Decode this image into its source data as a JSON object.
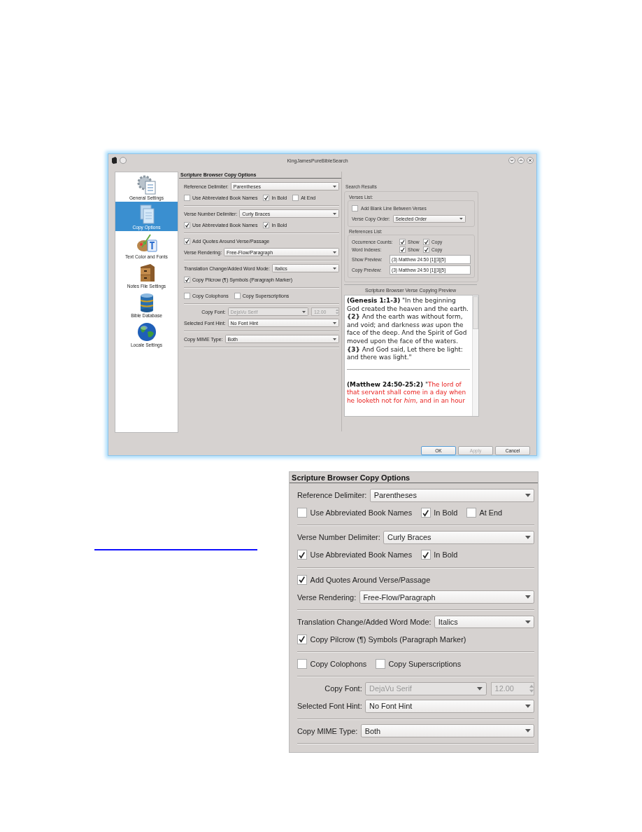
{
  "window": {
    "title": "KingJamesPureBibleSearch"
  },
  "sidebar": {
    "items": [
      {
        "label": "General Settings",
        "selected": false
      },
      {
        "label": "Copy Options",
        "selected": true
      },
      {
        "label": "Text Color and Fonts",
        "selected": false
      },
      {
        "label": "Notes File Settings",
        "selected": false
      },
      {
        "label": "Bible Database",
        "selected": false
      },
      {
        "label": "Locale Settings",
        "selected": false
      }
    ]
  },
  "copy_options": {
    "title": "Scripture Browser Copy Options",
    "sections": [
      {
        "rows": [
          {
            "kind": "select",
            "label": "Reference Delimiter:",
            "value": "Parentheses"
          },
          {
            "kind": "checks",
            "items": [
              {
                "label": "Use Abbreviated Book Names",
                "checked": false
              },
              {
                "label": "In Bold",
                "checked": true
              },
              {
                "label": "At End",
                "checked": false
              }
            ]
          }
        ]
      },
      {
        "rows": [
          {
            "kind": "select",
            "label": "Verse Number Delimiter:",
            "value": "Curly Braces"
          },
          {
            "kind": "checks",
            "items": [
              {
                "label": "Use Abbreviated Book Names",
                "checked": true
              },
              {
                "label": "In Bold",
                "checked": true
              }
            ]
          }
        ]
      },
      {
        "rows": [
          {
            "kind": "checks",
            "items": [
              {
                "label": "Add Quotes Around Verse/Passage",
                "checked": true
              }
            ]
          },
          {
            "kind": "select",
            "label": "Verse Rendering:",
            "value": "Free-Flow/Paragraph"
          }
        ]
      },
      {
        "rows": [
          {
            "kind": "select",
            "label": "Translation Change/Added Word Mode:",
            "value": "Italics"
          },
          {
            "kind": "checks",
            "items": [
              {
                "label": "Copy Pilcrow (¶) Symbols (Paragraph Marker)",
                "checked": true
              }
            ]
          }
        ]
      },
      {
        "rows": [
          {
            "kind": "checks",
            "items": [
              {
                "label": "Copy Colophons",
                "checked": false
              },
              {
                "label": "Copy Superscriptions",
                "checked": false
              }
            ]
          }
        ]
      },
      {
        "rows": [
          {
            "kind": "font",
            "label": "Copy Font:",
            "value": "DejaVu Serif",
            "size": "12.00",
            "disabled": true
          },
          {
            "kind": "select",
            "label": "Selected Font Hint:",
            "value": "No Font Hint"
          }
        ]
      },
      {
        "rows": [
          {
            "kind": "select",
            "label": "Copy MIME Type:",
            "value": "Both"
          }
        ]
      }
    ]
  },
  "search_results": {
    "title": "Search Results",
    "verses_list": {
      "title": "Verses List:",
      "blank_line": {
        "label": "Add Blank Line Between Verses",
        "checked": false
      },
      "order": {
        "label": "Verse Copy Order:",
        "value": "Selected Order"
      }
    },
    "references_list": {
      "title": "References List:",
      "toggles": [
        {
          "label": "Occurrence Counts:",
          "show": {
            "label": "Show",
            "checked": true
          },
          "copy": {
            "label": "Copy",
            "checked": true
          }
        },
        {
          "label": "Word Indexes:",
          "show": {
            "label": "Show",
            "checked": true
          },
          "copy": {
            "label": "Copy",
            "checked": true
          }
        }
      ],
      "previews": [
        {
          "label": "Show Preview:",
          "value": "(3) Matthew 24:50 [1][3][5]"
        },
        {
          "label": "Copy Preview:",
          "value": "(3) Matthew 24:50 [1][3][5]"
        }
      ]
    }
  },
  "preview": {
    "title": "Scripture Browser Verse Copying Preview",
    "paragraphs": [
      {
        "reference": "(Genesis 1:1-3)",
        "segments": [
          {
            "text": " \"In the beginning God created the heaven and the earth.  **{2}** And the earth was without form, and void; and darkness *was* upon the face of the deep. And the Spirit of God moved upon the face of the waters.  **{3}** And God said, Let there be light: and there was light.\"",
            "red": false
          }
        ]
      },
      {
        "reference": "(Matthew 24:50-25:2)",
        "segments": [
          {
            "text": " \"",
            "red": false
          },
          {
            "text": "The lord of that servant shall come in a day when he looketh not for *him*, and in an hour",
            "red": true
          }
        ]
      }
    ]
  },
  "buttons": [
    {
      "label": "OK",
      "default": true,
      "disabled": false
    },
    {
      "label": "Apply",
      "default": false,
      "disabled": true
    },
    {
      "label": "Cancel",
      "default": false,
      "disabled": false
    }
  ],
  "detail_view": {
    "title": "Scripture Browser Copy Options",
    "sections": [
      {
        "rows": [
          {
            "kind": "select",
            "label": "Reference Delimiter:",
            "value": "Parentheses"
          },
          {
            "kind": "checks",
            "items": [
              {
                "label": "Use Abbreviated Book Names",
                "checked": false
              },
              {
                "label": "In Bold",
                "checked": true
              },
              {
                "label": "At End",
                "checked": false
              }
            ]
          }
        ]
      },
      {
        "rows": [
          {
            "kind": "select",
            "label": "Verse Number Delimiter:",
            "value": "Curly Braces"
          },
          {
            "kind": "checks",
            "items": [
              {
                "label": "Use Abbreviated Book Names",
                "checked": true
              },
              {
                "label": "In Bold",
                "checked": true
              }
            ]
          }
        ]
      },
      {
        "rows": [
          {
            "kind": "checks",
            "items": [
              {
                "label": "Add Quotes Around Verse/Passage",
                "checked": true
              }
            ]
          },
          {
            "kind": "select",
            "label": "Verse Rendering:",
            "value": "Free-Flow/Paragraph"
          }
        ]
      },
      {
        "rows": [
          {
            "kind": "select",
            "label": "Translation Change/Added Word Mode:",
            "value": "Italics"
          },
          {
            "kind": "checks",
            "items": [
              {
                "label": "Copy Pilcrow (¶) Symbols (Paragraph Marker)",
                "checked": true
              }
            ]
          }
        ]
      },
      {
        "rows": [
          {
            "kind": "checks",
            "items": [
              {
                "label": "Copy Colophons",
                "checked": false
              },
              {
                "label": "Copy Superscriptions",
                "checked": false
              }
            ]
          }
        ]
      },
      {
        "rows": [
          {
            "kind": "font",
            "label": "Copy Font:",
            "value": "DejaVu Serif",
            "size": "12.00",
            "disabled": true
          },
          {
            "kind": "select",
            "label": "Selected Font Hint:",
            "value": "No Font Hint"
          }
        ]
      },
      {
        "rows": [
          {
            "kind": "select",
            "label": "Copy MIME Type:",
            "value": "Both"
          }
        ]
      }
    ]
  }
}
